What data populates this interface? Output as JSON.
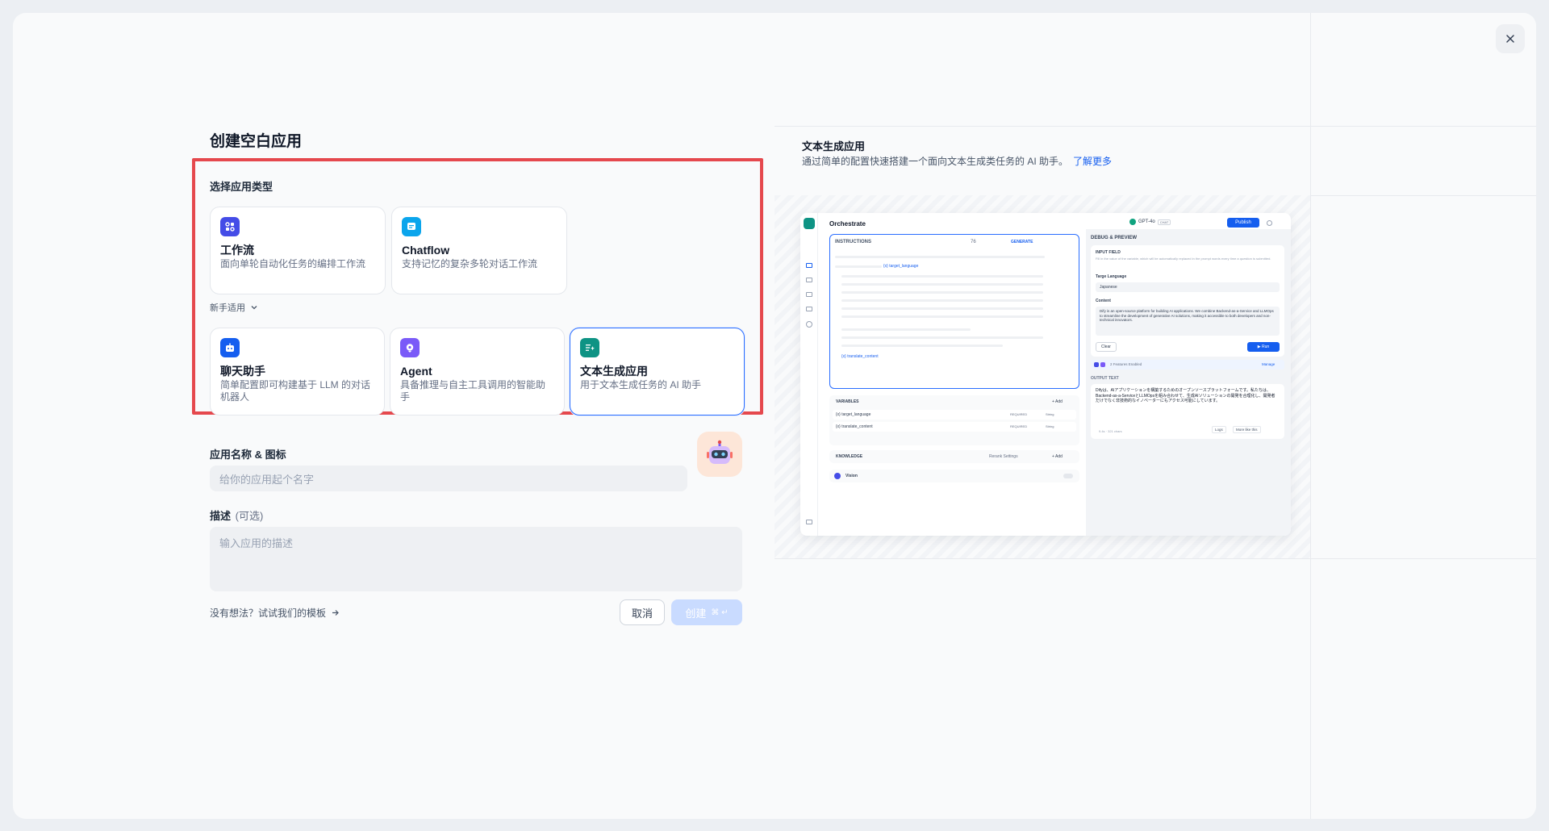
{
  "modal": {
    "title": "创建空白应用",
    "app_type_label": "选择应用类型",
    "beginner_label": "新手适用",
    "types_advanced": [
      {
        "name": "工作流",
        "desc": "面向单轮自动化任务的编排工作流",
        "color": "#444ce7",
        "icon": "workflow-icon"
      },
      {
        "name": "Chatflow",
        "desc": "支持记忆的复杂多轮对话工作流",
        "color": "#0ba5ec",
        "icon": "chatflow-icon"
      }
    ],
    "types_beginner": [
      {
        "name": "聊天助手",
        "desc": "简单配置即可构建基于 LLM 的对话机器人",
        "color": "#155eef",
        "icon": "chat-assistant-icon"
      },
      {
        "name": "Agent",
        "desc": "具备推理与自主工具调用的智能助手",
        "color": "#7a5af8",
        "icon": "agent-icon"
      },
      {
        "name": "文本生成应用",
        "desc": "用于文本生成任务的 AI 助手",
        "color": "#0e9384",
        "icon": "text-gen-icon"
      }
    ],
    "name_label": "应用名称 & 图标",
    "name_placeholder": "给你的应用起个名字",
    "desc_label": "描述",
    "desc_optional": "(可选)",
    "desc_placeholder": "输入应用的描述",
    "template_link": "没有想法？试试我们的模板",
    "cancel": "取消",
    "create": "创建",
    "create_shortcut": "⌘ ↵"
  },
  "preview": {
    "title": "文本生成应用",
    "desc": "通过简单的配置快速搭建一个面向文本生成类任务的 AI 助手。",
    "learn_more": "了解更多",
    "shot": {
      "header": "Orchestrate",
      "model": "GPT-4o",
      "model_tag": "CHAT",
      "publish": "Publish",
      "instructions": "INSTRUCTIONS",
      "token_count": "76",
      "generate": "GENERATE",
      "var1": "{x} target_language",
      "var2": "{x} translate_content",
      "variables": "VARIABLES",
      "add": "+ Add",
      "row1": "{x} target_language",
      "row2": "{x} translate_content",
      "required": "REQUIRED",
      "string": "String",
      "knowledge": "KNOWLEDGE",
      "rerank": "Rerank Settings",
      "vision": "Vision",
      "debug": "DEBUG & PREVIEW",
      "input_field": "INPUT FIELD",
      "input_hint": "Fill in the value of the variable, which will be automatically replaced in the prompt words every time a question is submitted.",
      "target_lang_label": "Targe Language",
      "target_lang_value": "Japanese",
      "content_label": "Content",
      "content_value": "Dify is an open-source platform for building AI applications. We combine Backend-as-a-Service and LLMOps to streamline the development of generative AI solutions, making it accessible to both developers and non-technical innovators.",
      "clear": "Clear",
      "run": "▶ Run",
      "features": "2 Features Enabled",
      "manage": "Manage",
      "output_label": "OUTPUT TEXT",
      "output_value": "Difyは、AIアプリケーションを構築するためのオープンソースプラットフォームです。私たちは、Backend-as-a-ServiceとLLMOpsを組み合わせて、生成AIソリューションの開発を合理化し、開発者だけでなく非技術的なイノベーターにもアクセス可能にしています。",
      "meta": "9.4s · 321 chars",
      "logs": "Logs",
      "more_like": "More like this"
    }
  }
}
